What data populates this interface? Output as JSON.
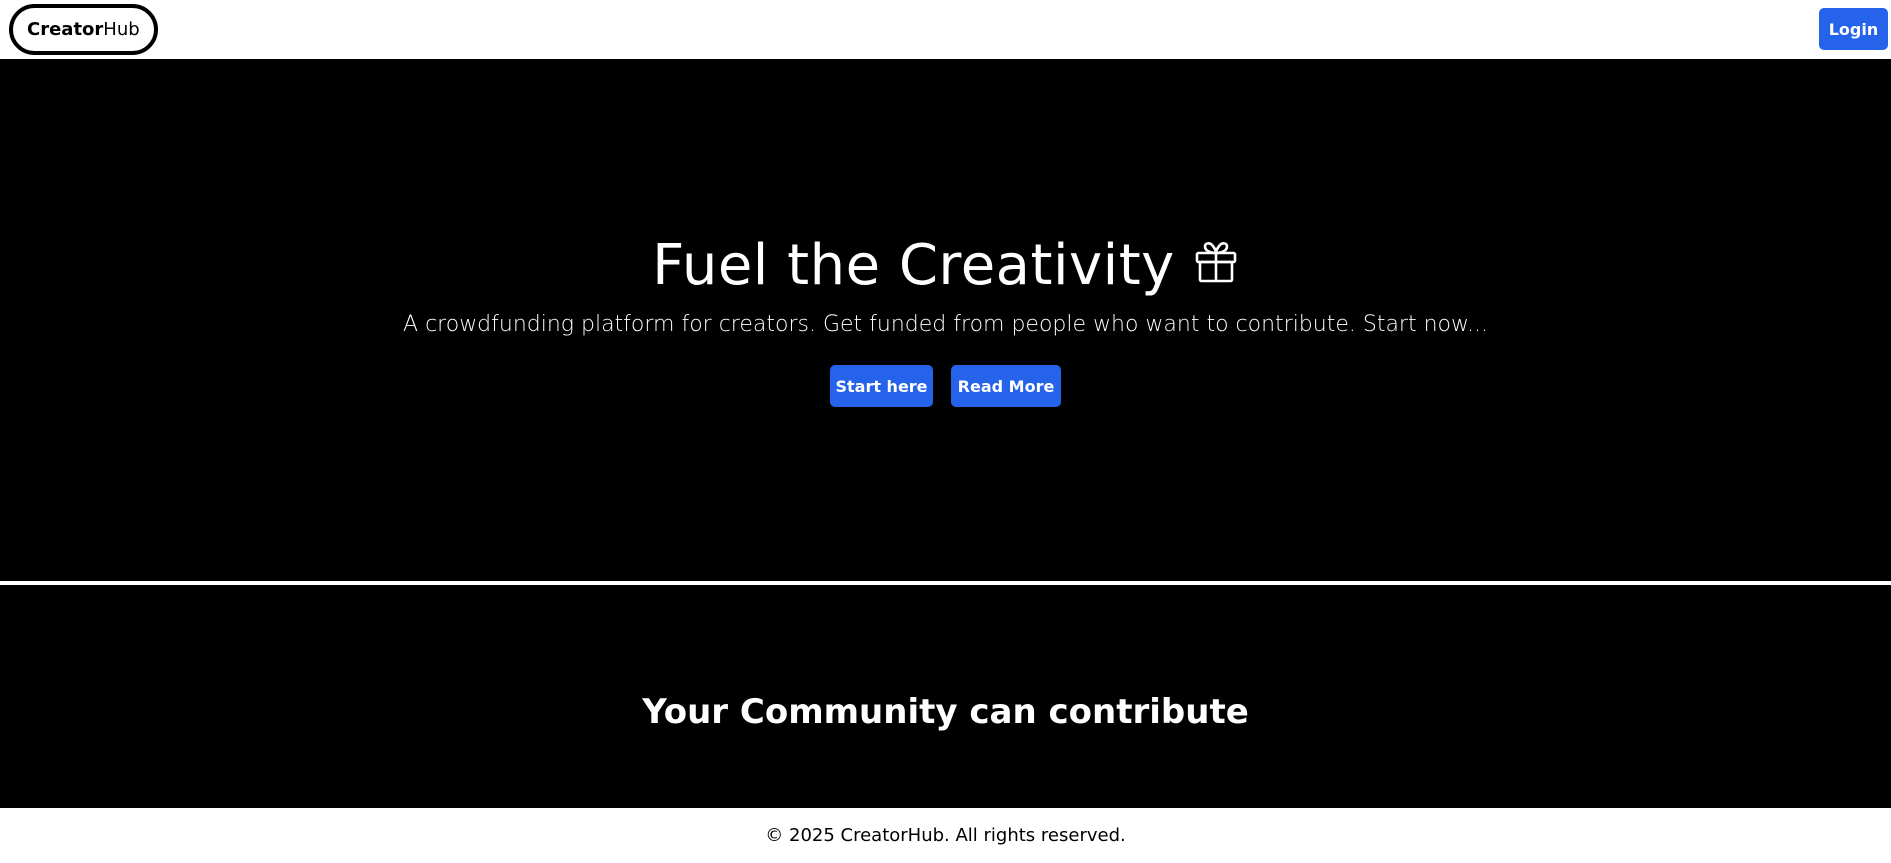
{
  "navbar": {
    "logo_bold": "Creator",
    "logo_light": "Hub",
    "login_label": "Login"
  },
  "hero": {
    "title": "Fuel the Creativity",
    "title_icon": "gift-icon",
    "subtitle": "A crowdfunding platform for creators. Get funded from people who want to contribute. Start now...",
    "start_label": "Start here",
    "read_more_label": "Read More"
  },
  "community": {
    "title": "Your Community can contribute"
  },
  "footer": {
    "copyright": "© 2025 CreatorHub. All rights reserved."
  },
  "colors": {
    "accent": "#2563eb",
    "hero_background": "#000000",
    "page_background": "#ffffff"
  }
}
